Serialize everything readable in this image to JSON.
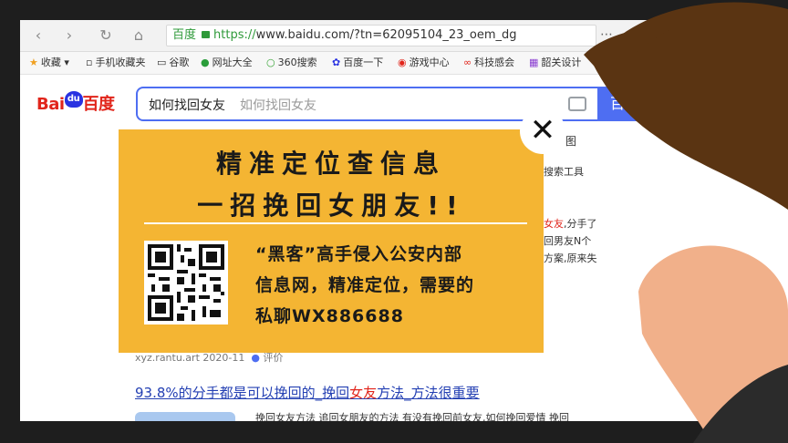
{
  "browser": {
    "url_cert": "百度",
    "url_scheme": "https://",
    "url_rest": "www.baidu.com/?tn=62095104_23_oem_dg"
  },
  "bookmarks": [
    {
      "icon": "star-icon",
      "label": "收藏"
    },
    {
      "icon": "phone-icon",
      "label": "手机收藏夹"
    },
    {
      "icon": "page-icon",
      "label": "谷歌"
    },
    {
      "icon": "globe-icon",
      "label": "网址大全"
    },
    {
      "icon": "360-icon",
      "label": "360搜索"
    },
    {
      "icon": "paw-icon",
      "label": "百度一下"
    },
    {
      "icon": "game-icon",
      "label": "游戏中心"
    },
    {
      "icon": "tech-icon",
      "label": "科技感会"
    },
    {
      "icon": "design-icon",
      "label": "韶关设计"
    }
  ],
  "search": {
    "logo_bai": "Bai",
    "logo_paw": "du",
    "logo_cn": "百度",
    "query": "如何找回女友",
    "suggestion": "如何找回女友",
    "button_label": "百度"
  },
  "right_fragments": {
    "tab_image": "图",
    "tools": "搜索工具",
    "snip1_red": "女友",
    "snip1": ",分手了",
    "snip2": "回男友N个",
    "snip3": "方案,原来失"
  },
  "result": {
    "meta": "xyz.rantu.art 2020-11",
    "eval": "评价",
    "title_a": "93.8%的分手都是可以挽回的_挽回",
    "title_red": "女友",
    "title_b": "方法_方法很重要",
    "snippet": "挽回女友方法 追回女朋友的方法 有没有挽回前女友,如何挽回爱情 挽回"
  },
  "ad": {
    "line1": "精准定位查信息",
    "line2": "一招挽回女朋友!!",
    "body1": "“黑客”高手侵入公安内部",
    "body2": "信息网，精准定位，需要的",
    "body3": "私聊WX886688",
    "close": "✕"
  },
  "colors": {
    "ad_bg": "#f4b533",
    "baidu_blue": "#4e6ef2",
    "baidu_red": "#e1251b",
    "hair": "#5a3412",
    "skin": "#f1b08a"
  }
}
